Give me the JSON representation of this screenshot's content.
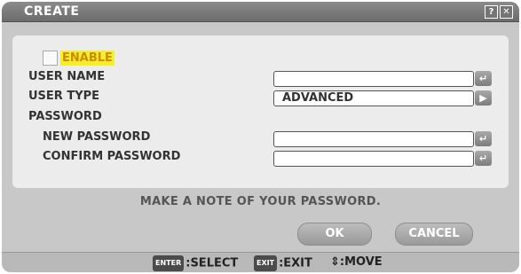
{
  "window": {
    "title": "CREATE",
    "help_icon": "?",
    "close_icon": "✕"
  },
  "form": {
    "enable_label": "ENABLE",
    "user_name_label": "USER NAME",
    "user_type_label": "USER TYPE",
    "user_type_value": "ADVANCED",
    "password_label": "PASSWORD",
    "new_password_label": "NEW PASSWORD",
    "confirm_password_label": "CONFIRM PASSWORD",
    "enter_icon": "↵",
    "arrow_icon": "▶"
  },
  "note": "MAKE A NOTE OF YOUR PASSWORD.",
  "buttons": {
    "ok": "OK",
    "cancel": "CANCEL"
  },
  "footer": {
    "enter_key": "ENTER",
    "select_label": ":SELECT",
    "exit_key": "EXIT",
    "exit_label": ":EXIT",
    "move_icon": "⇕",
    "move_label": ":MOVE"
  }
}
